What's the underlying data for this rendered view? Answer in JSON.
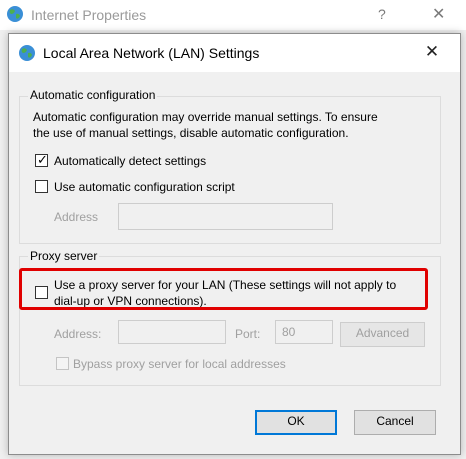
{
  "background_window": {
    "title": "Internet Properties",
    "help_glyph": "?",
    "close_glyph": "✕"
  },
  "dialog": {
    "title": "Local Area Network (LAN) Settings",
    "close_glyph": "✕"
  },
  "automatic_configuration": {
    "legend": "Automatic configuration",
    "description_line1": "Automatic configuration may override manual settings.  To ensure",
    "description_line2": "the use of manual settings, disable automatic configuration.",
    "detect_settings_label": "Automatically detect settings",
    "detect_settings_checked": true,
    "use_script_label": "Use automatic configuration script",
    "use_script_checked": false,
    "address_label": "Address",
    "address_value": ""
  },
  "proxy_server": {
    "legend": "Proxy server",
    "use_proxy_line1": "Use a proxy server for your LAN (These settings will not apply to",
    "use_proxy_line2": "dial-up or VPN connections).",
    "use_proxy_checked": false,
    "address_label": "Address:",
    "address_value": "",
    "port_label": "Port:",
    "port_value": "80",
    "advanced_button": "Advanced",
    "bypass_label": "Bypass proxy server for local addresses",
    "bypass_checked": false
  },
  "buttons": {
    "ok": "OK",
    "cancel": "Cancel"
  },
  "colors": {
    "highlight_border": "#e00000",
    "primary_button_border": "#0078d7"
  },
  "icons": [
    "globe-icon",
    "close-icon",
    "help-icon",
    "check-icon"
  ]
}
